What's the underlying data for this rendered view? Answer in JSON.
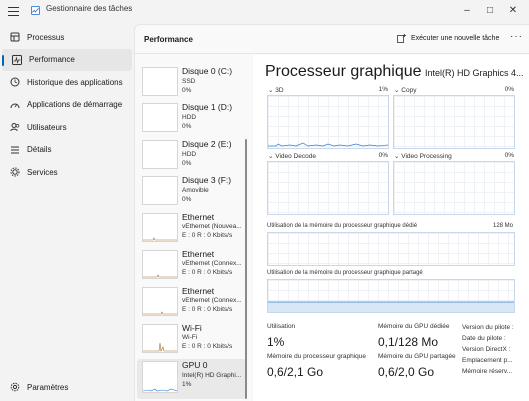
{
  "window": {
    "title": "Gestionnaire des tâches",
    "controls": {
      "minimize": "–",
      "maximize": "□",
      "close": "✕"
    }
  },
  "nav": {
    "items": [
      {
        "label": "Processus",
        "icon": "grid-icon"
      },
      {
        "label": "Performance",
        "icon": "pulse-icon",
        "active": true
      },
      {
        "label": "Historique des applications",
        "icon": "history-icon"
      },
      {
        "label": "Applications de démarrage",
        "icon": "speedometer-icon"
      },
      {
        "label": "Utilisateurs",
        "icon": "users-icon"
      },
      {
        "label": "Détails",
        "icon": "list-icon"
      },
      {
        "label": "Services",
        "icon": "services-icon"
      }
    ],
    "settings_label": "Paramètres"
  },
  "header": {
    "title": "Performance",
    "run_task_label": "Exécuter une nouvelle tâche",
    "more": "···"
  },
  "devices": [
    {
      "name": "Disque 0 (C:)",
      "sub1": "SSD",
      "sub2": "0%"
    },
    {
      "name": "Disque 1 (D:)",
      "sub1": "HDD",
      "sub2": "0%"
    },
    {
      "name": "Disque 2 (E:)",
      "sub1": "HDD",
      "sub2": "0%"
    },
    {
      "name": "Disque 3 (F:)",
      "sub1": "Amovible",
      "sub2": "0%"
    },
    {
      "name": "Ethernet",
      "sub1": "vEthernet (Nouvea...",
      "sub2": "E : 0 R : 0 Kbits/s"
    },
    {
      "name": "Ethernet",
      "sub1": "vEthernet (Connex...",
      "sub2": "E : 0 R : 0 Kbits/s"
    },
    {
      "name": "Ethernet",
      "sub1": "vEthernet (Connex...",
      "sub2": "E : 0 R : 0 Kbits/s"
    },
    {
      "name": "Wi-Fi",
      "sub1": "Wi-Fi",
      "sub2": "E : 0 R : 0 Kbits/s"
    },
    {
      "name": "GPU 0",
      "sub1": "Intel(R) HD Graphi...",
      "sub2": "1%"
    }
  ],
  "partial_top_label": "...",
  "gpu": {
    "title": "Processeur graphique",
    "model": "Intel(R) HD Graphics 4...",
    "graphs": {
      "g3d": {
        "label": "3D",
        "value": "1%"
      },
      "copy": {
        "label": "Copy",
        "value": "0%"
      },
      "video_decode": {
        "label": "Video Decode",
        "value": "0%"
      },
      "video_processing": {
        "label": "Video Processing",
        "value": "0%"
      }
    },
    "dedicated_mem_label": "Utilisation de la mémoire du processeur graphique dédié",
    "dedicated_mem_max": "128 Mo",
    "shared_mem_label": "Utilisation de la mémoire du processeur graphique partagé",
    "stats": {
      "utilization_label": "Utilisation",
      "utilization_value": "1%",
      "dedicated_label": "Mémoire du GPU dédiée",
      "dedicated_value": "0,1/128 Mo",
      "gpu_mem_label": "Mémoire du processeur graphique",
      "gpu_mem_value": "0,6/2,1 Go",
      "shared_label": "Mémoire du GPU partagée",
      "shared_value": "0,6/2,0 Go"
    },
    "info": [
      "Version du pilote :",
      "Date du pilote :",
      "Version DirectX :",
      "Emplacement p...",
      "Mémoire réserv..."
    ]
  },
  "colors": {
    "accent": "#0067c0",
    "gpu_graph": "#2e7dd6",
    "disk_graph": "#6bb33f",
    "net_graph": "#a76f2b"
  }
}
